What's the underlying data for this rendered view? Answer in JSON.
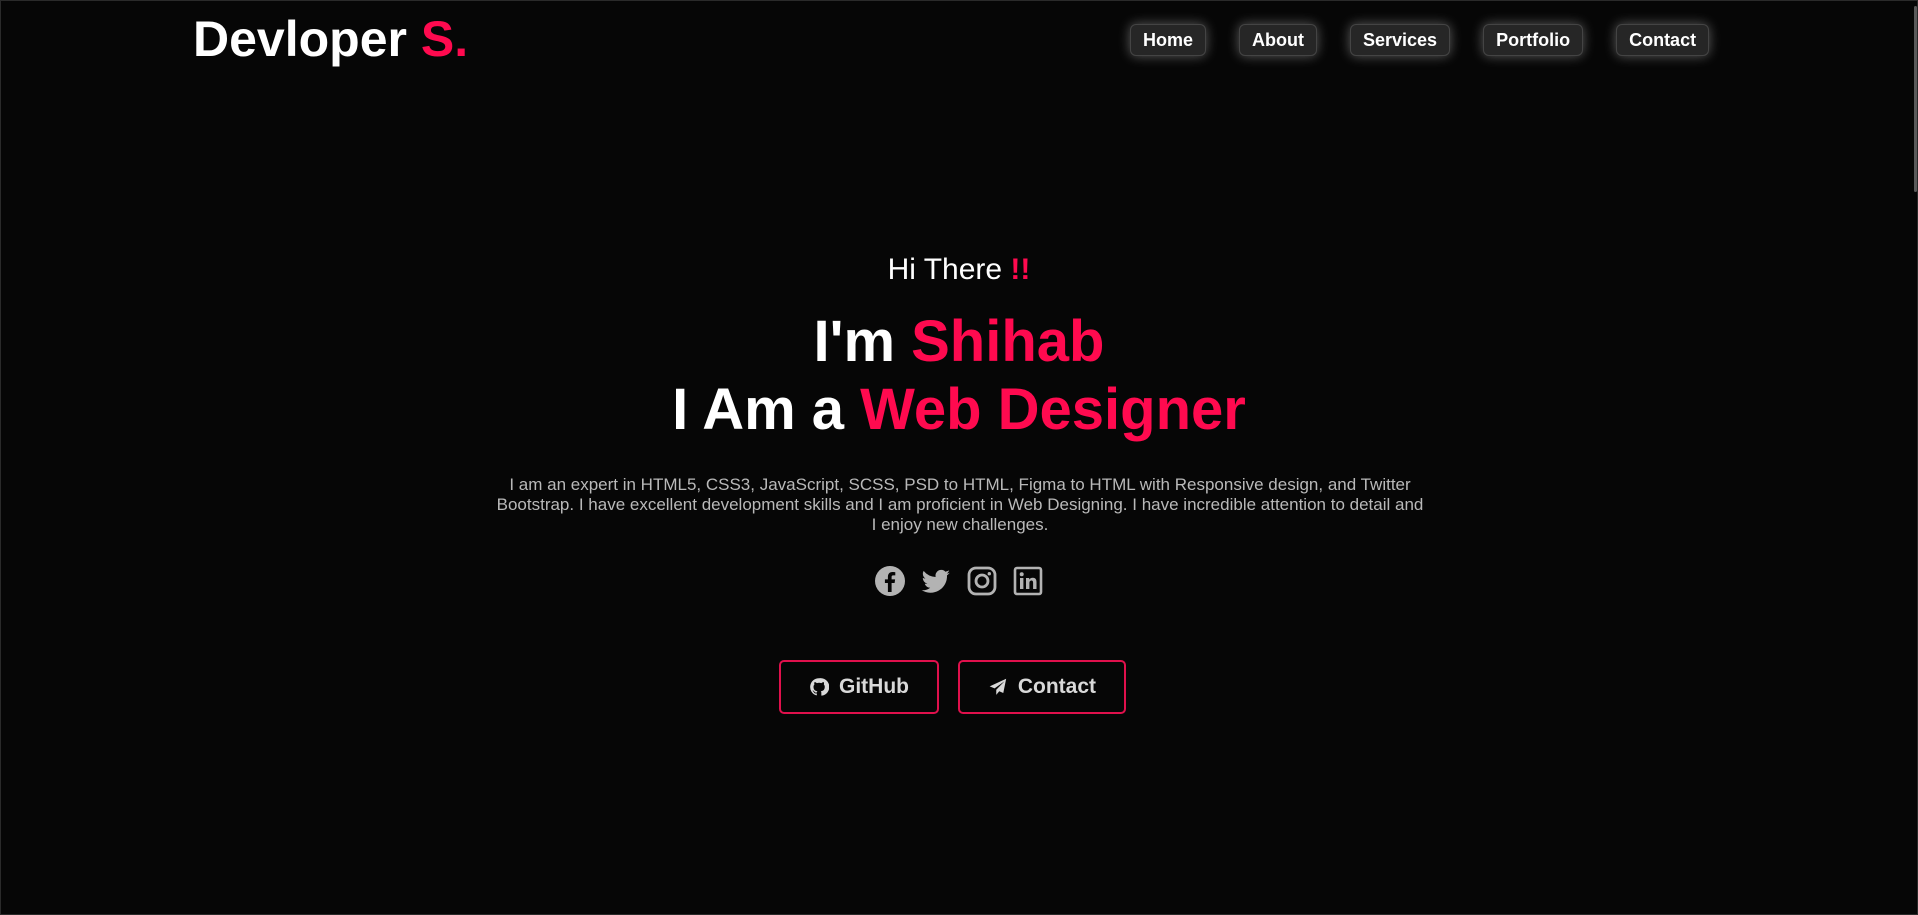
{
  "brand": {
    "name": "Devloper ",
    "accent": "S."
  },
  "nav": [
    {
      "label": "Home"
    },
    {
      "label": "About"
    },
    {
      "label": "Services"
    },
    {
      "label": "Portfolio"
    },
    {
      "label": "Contact"
    }
  ],
  "hero": {
    "greeting": "Hi There ",
    "greeting_accent": "!!",
    "line1_prefix": "I'm ",
    "line1_accent": "Shihab",
    "line2_prefix": "I Am a ",
    "line2_accent": "Web Designer",
    "description": "I am an expert in HTML5, CSS3, JavaScript, SCSS, PSD to HTML, Figma to HTML with Responsive design, and Twitter Bootstrap. I have excellent development skills and I am proficient in Web Designing. I have incredible attention to detail and I enjoy new challenges."
  },
  "socials": [
    "facebook-icon",
    "twitter-icon",
    "instagram-icon",
    "linkedin-icon"
  ],
  "buttons": {
    "github": "GitHub",
    "contact": "Contact"
  },
  "colors": {
    "accent": "#ff0a4f",
    "background": "#060606",
    "button_border": "#e0104c"
  }
}
